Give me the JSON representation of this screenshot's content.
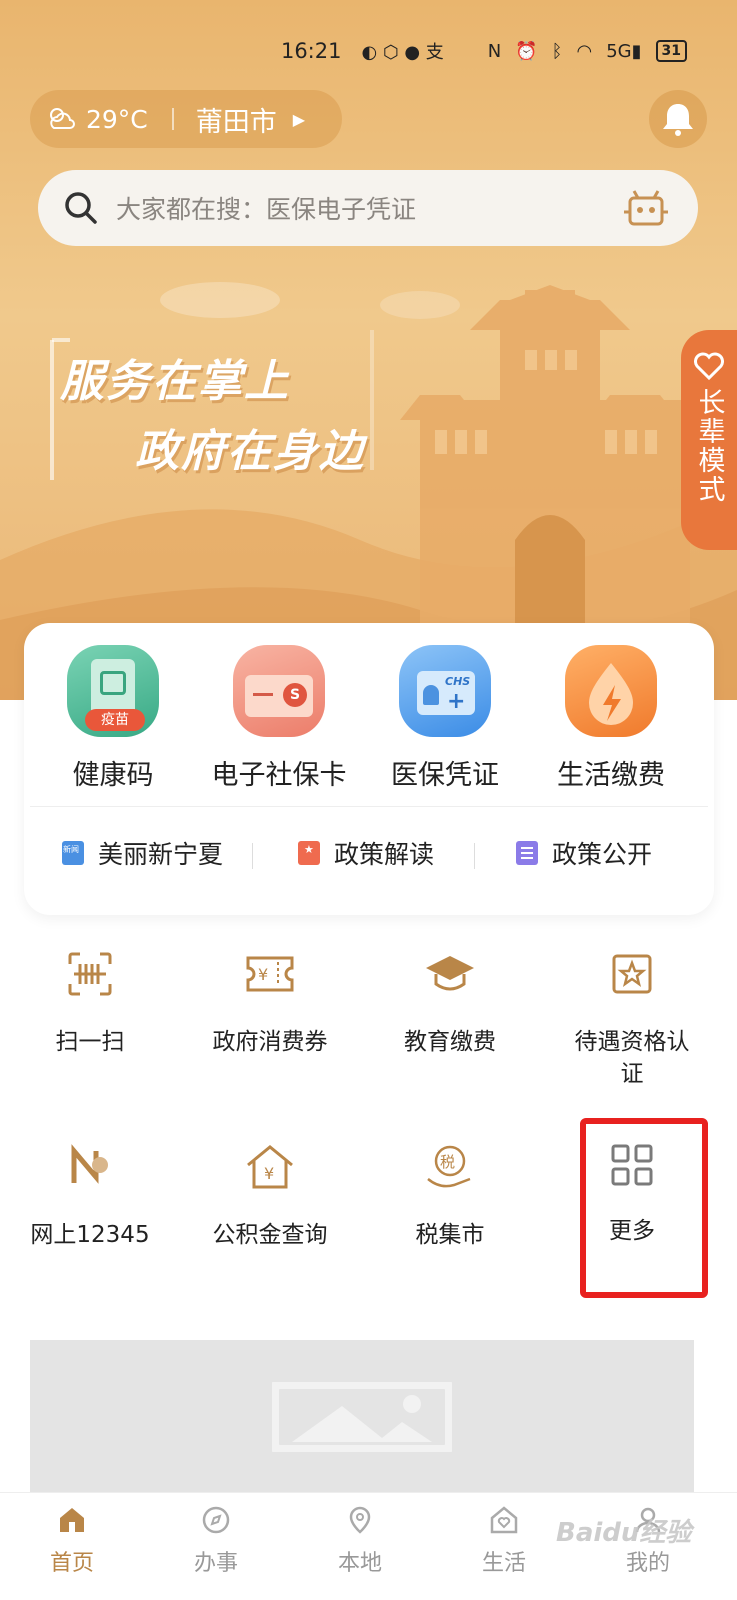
{
  "status_bar": {
    "time": "16:21",
    "network": "5G",
    "battery": "31"
  },
  "weather": {
    "temperature": "29°C",
    "city": "莆田市"
  },
  "search": {
    "placeholder": "大家都在搜：医保电子凭证"
  },
  "hero": {
    "slogan_line1": "服务在掌上",
    "slogan_line2": "政府在身边",
    "elder_mode": "长辈模式"
  },
  "quick_services": [
    {
      "label": "健康码",
      "badge": "疫苗"
    },
    {
      "label": "电子社保卡"
    },
    {
      "label": "医保凭证",
      "badge": "CHS"
    },
    {
      "label": "生活缴费"
    }
  ],
  "news_links": [
    {
      "label": "美丽新宁夏",
      "icon_text": "新闻"
    },
    {
      "label": "政策解读"
    },
    {
      "label": "政策公开"
    }
  ],
  "services": [
    {
      "label": "扫一扫"
    },
    {
      "label": "政府消费券",
      "icon_text": "¥"
    },
    {
      "label": "教育缴费"
    },
    {
      "label": "待遇资格认证"
    },
    {
      "label": "网上12345"
    },
    {
      "label": "公积金查询",
      "icon_text": "¥"
    },
    {
      "label": "税集市",
      "icon_text": "税"
    },
    {
      "label": "更多"
    }
  ],
  "tabbar": [
    {
      "label": "首页",
      "active": true
    },
    {
      "label": "办事"
    },
    {
      "label": "本地"
    },
    {
      "label": "生活"
    },
    {
      "label": "我的"
    }
  ],
  "watermark": "Baidu经验",
  "colors": {
    "accent": "#b98648",
    "hero_top": "#e9b56e",
    "elder_tab": "#e8773c",
    "highlight_border": "#e8211f"
  }
}
